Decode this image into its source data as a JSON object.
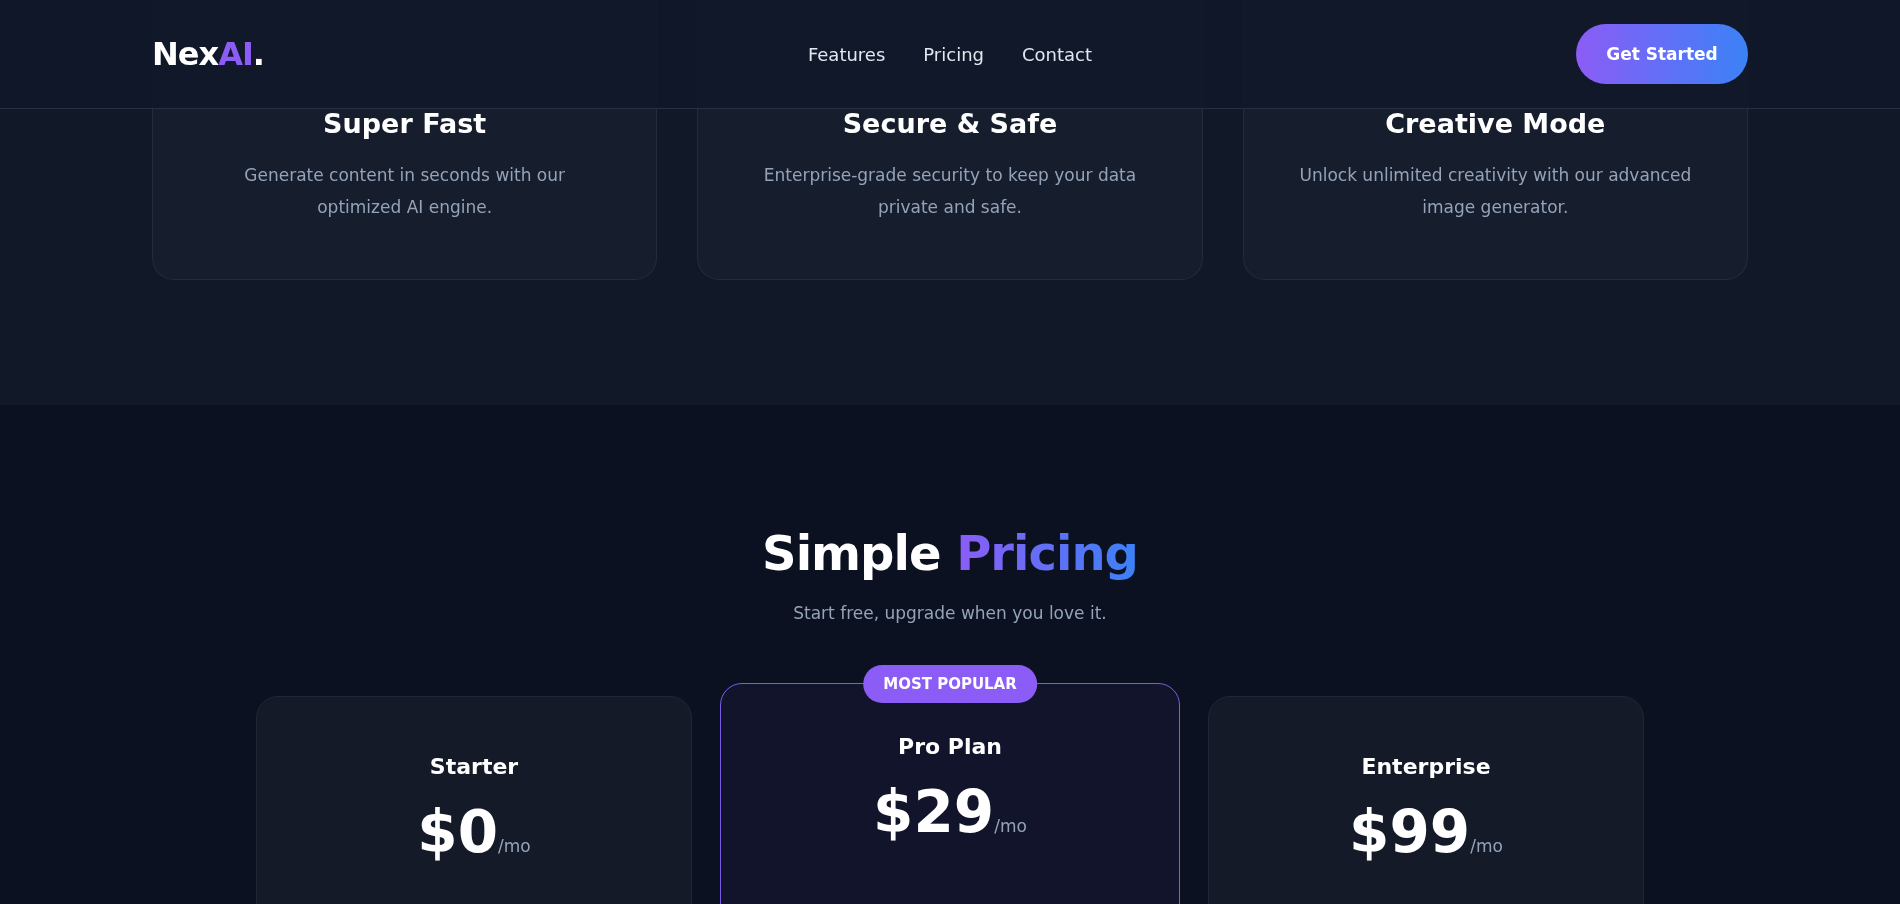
{
  "header": {
    "logo": {
      "main": "Nex",
      "accent": "AI",
      "dot": "."
    },
    "nav": [
      "Features",
      "Pricing",
      "Contact"
    ],
    "cta": "Get Started"
  },
  "features": [
    {
      "title": "Super Fast",
      "text": "Generate content in seconds with our optimized AI engine."
    },
    {
      "title": "Secure & Safe",
      "text": "Enterprise-grade security to keep your data private and safe."
    },
    {
      "title": "Creative Mode",
      "text": "Unlock unlimited creativity with our advanced image generator."
    }
  ],
  "pricing": {
    "title": "Simple",
    "title_accent": "Pricing",
    "subtitle": "Start free, upgrade when you love it.",
    "plans": [
      {
        "name": "Starter",
        "price": "$0",
        "period": "/mo",
        "featured": false
      },
      {
        "name": "Pro Plan",
        "price": "$29",
        "period": "/mo",
        "featured": true,
        "badge": "MOST POPULAR"
      },
      {
        "name": "Enterprise",
        "price": "$99",
        "period": "/mo",
        "featured": false
      }
    ]
  }
}
